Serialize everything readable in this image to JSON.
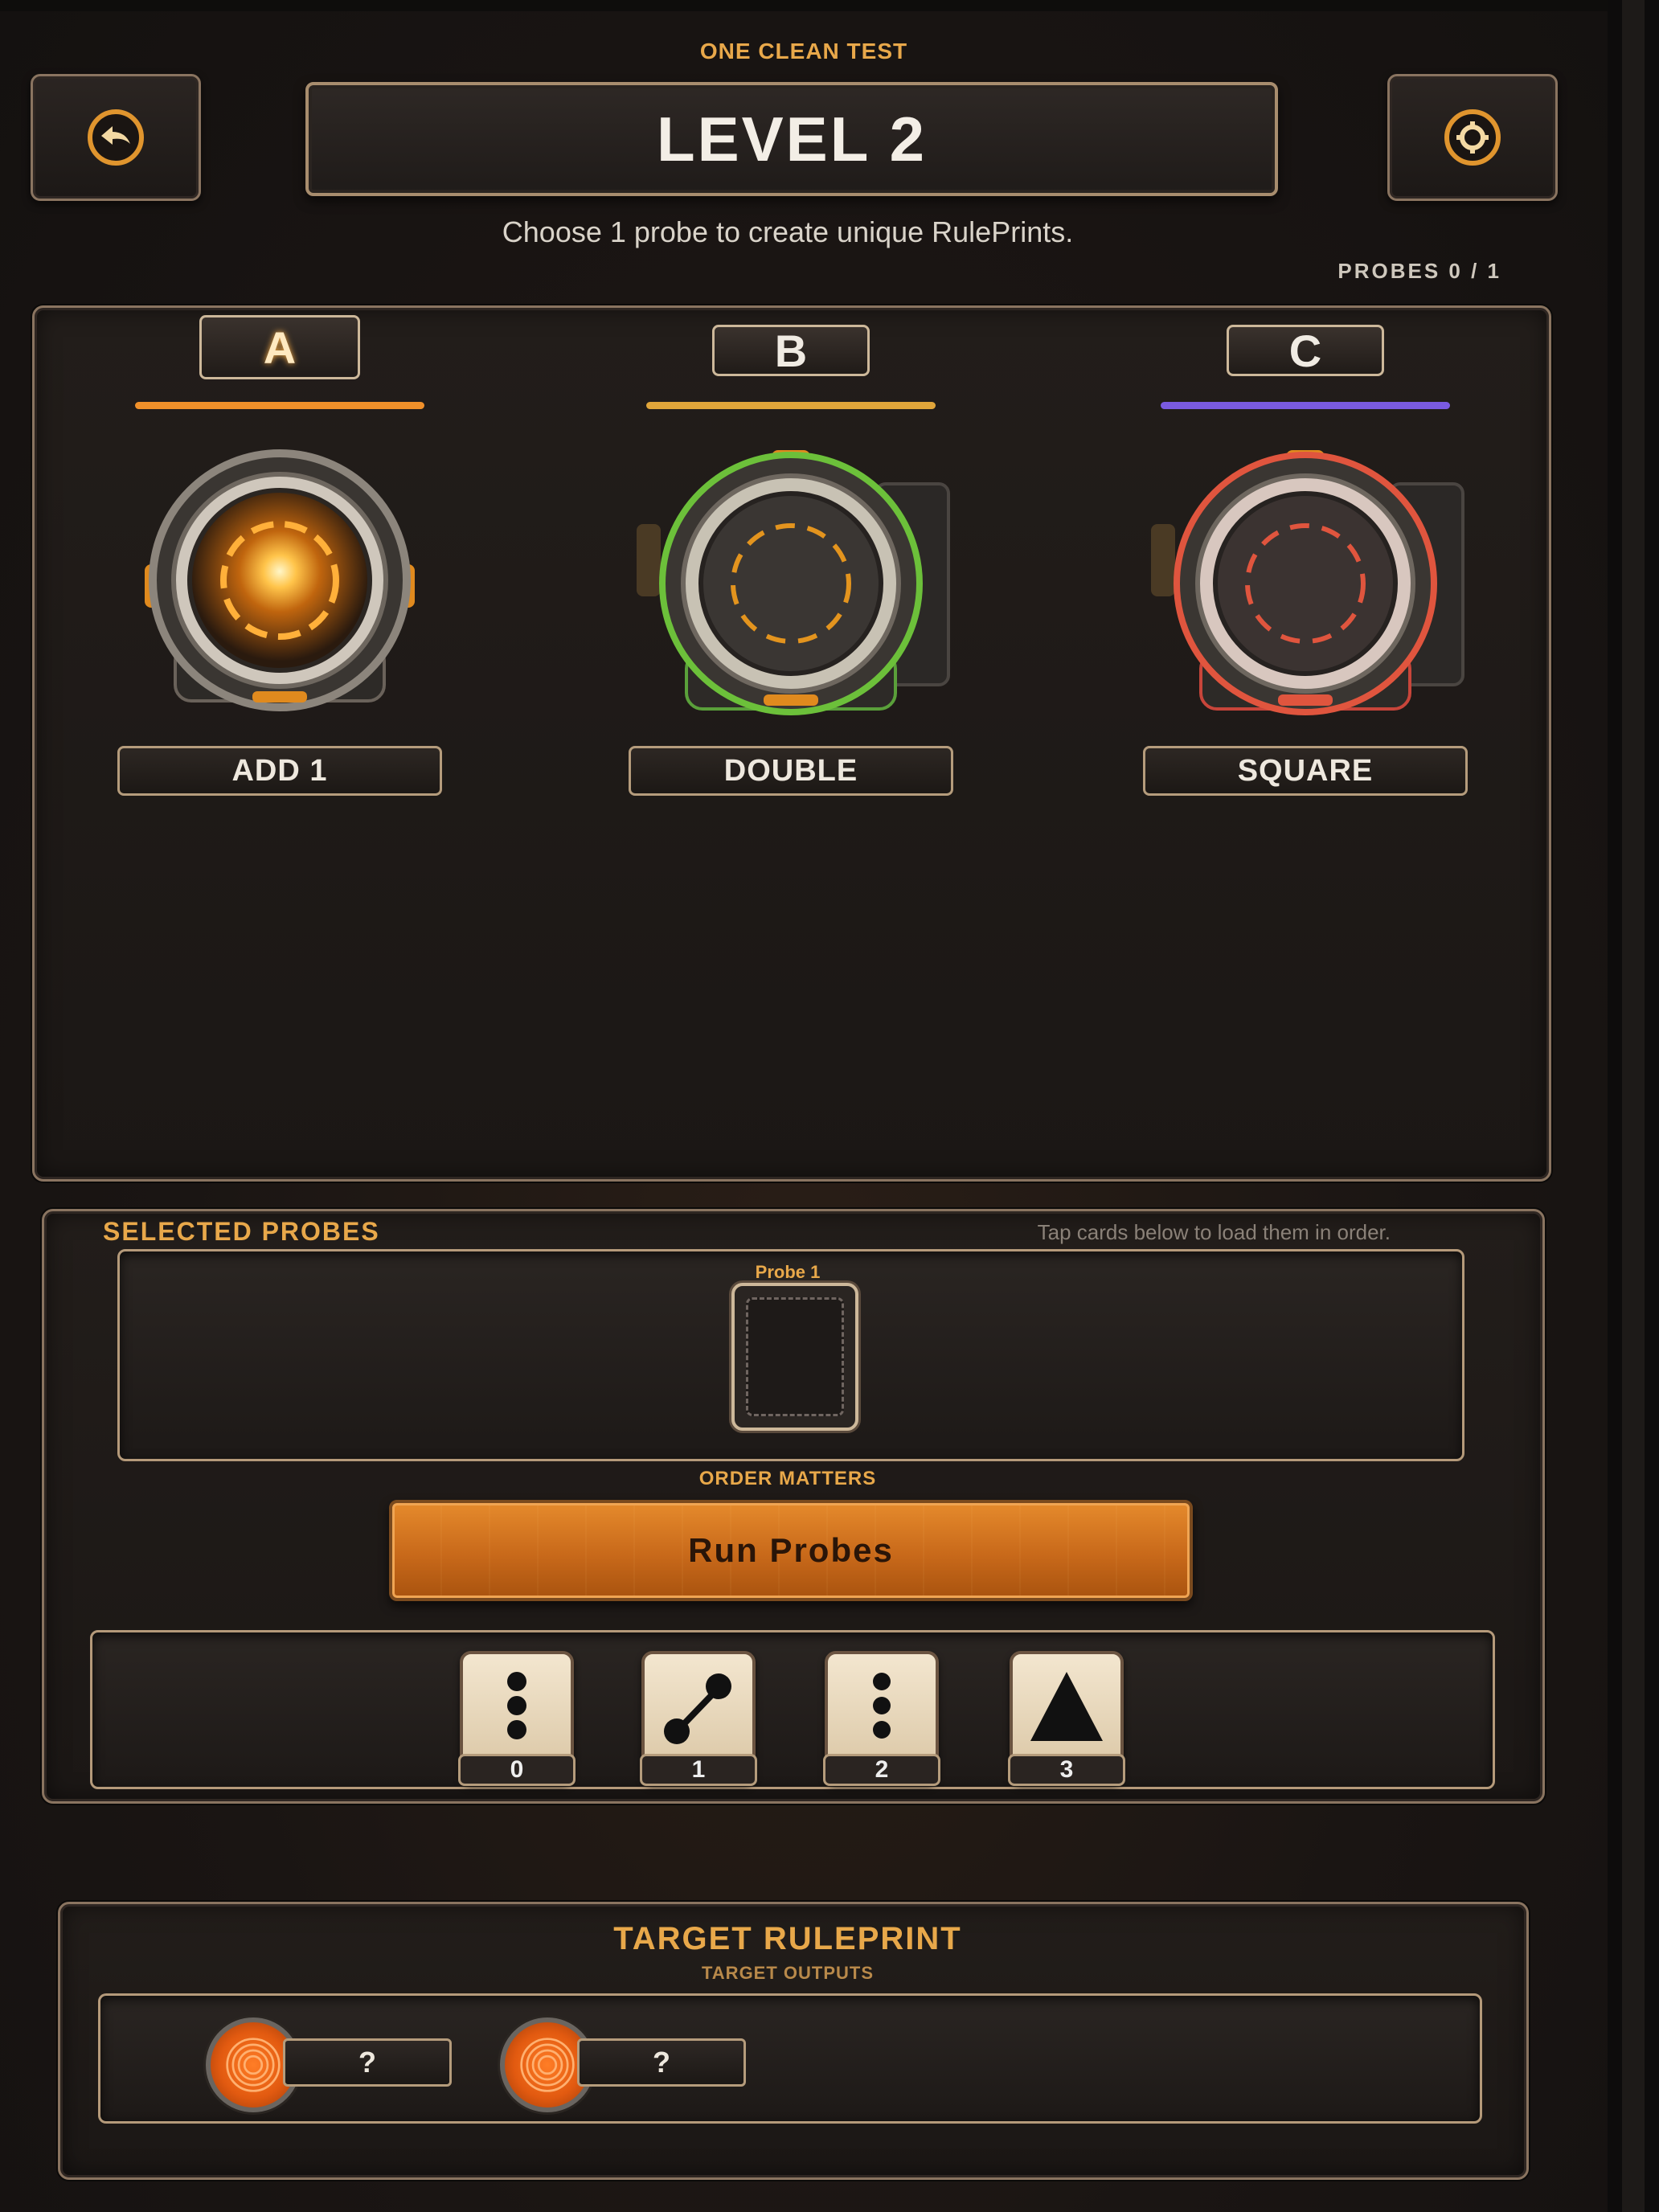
{
  "header": {
    "subtitle": "ONE CLEAN TEST",
    "level_title": "LEVEL 2",
    "back_icon": "back-arrow-icon",
    "settings_icon": "gear-icon",
    "instructions": "Choose 1 probe to create unique RulePrints.",
    "probes_count": "PROBES 0 / 1"
  },
  "probes": [
    {
      "letter": "A",
      "name": "ADD 1",
      "accent": "#f0902a",
      "ring": "#f0a030",
      "state": "selected"
    },
    {
      "letter": "B",
      "name": "DOUBLE",
      "accent": "#e0a53a",
      "ring": "#7cc24a",
      "state": "available"
    },
    {
      "letter": "C",
      "name": "SQUARE",
      "accent": "#7a5ae0",
      "ring": "#e0553e",
      "state": "available"
    }
  ],
  "selected": {
    "title": "SELECTED PROBES",
    "hint": "Tap cards below to load them in order.",
    "slot_label": "Probe 1",
    "order_note": "ORDER MATTERS",
    "run_label": "Run Probes"
  },
  "cards": [
    {
      "value": "0",
      "icon": "three-dots-vertical-icon"
    },
    {
      "value": "1",
      "icon": "connected-dots-icon"
    },
    {
      "value": "2",
      "icon": "three-dots-vertical-icon"
    },
    {
      "value": "3",
      "icon": "triangle-icon"
    }
  ],
  "target": {
    "title": "TARGET RULEPRINT",
    "subtitle": "TARGET OUTPUTS",
    "outputs": [
      {
        "value": "?",
        "icon": "fingerprint-icon"
      },
      {
        "value": "?",
        "icon": "fingerprint-icon"
      }
    ]
  }
}
